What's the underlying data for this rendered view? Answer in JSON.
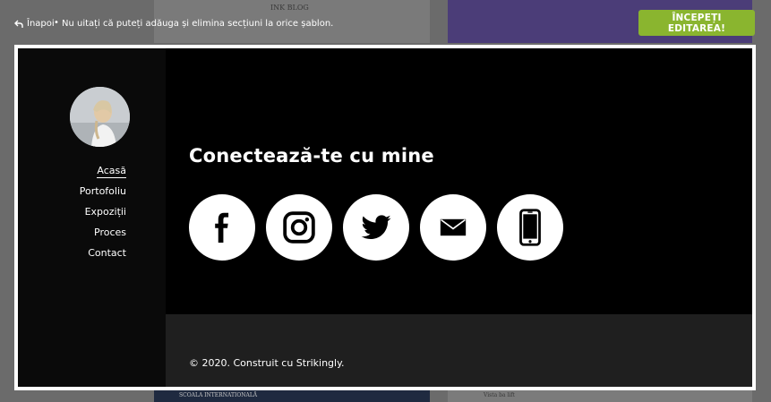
{
  "topbar": {
    "back_label": "Înapoi",
    "separator": "•",
    "hint": "Nu uitați că puteți adăuga și elimina secțiuni la orice șablon.",
    "start_button": "ÎNCEPEȚI EDITAREA!"
  },
  "background": {
    "left_top_logo": "INK BLOG",
    "left_bottom_text": "SCOALA INTERNATIONALĂ",
    "right_bottom_text": "Vista ba lift"
  },
  "sidebar": {
    "items": [
      {
        "label": "Acasă",
        "active": true
      },
      {
        "label": "Portofoliu",
        "active": false
      },
      {
        "label": "Expoziții",
        "active": false
      },
      {
        "label": "Proces",
        "active": false
      },
      {
        "label": "Contact",
        "active": false
      }
    ]
  },
  "main": {
    "heading": "Conectează-te cu mine",
    "social": [
      {
        "icon": "facebook-icon"
      },
      {
        "icon": "instagram-icon"
      },
      {
        "icon": "twitter-icon"
      },
      {
        "icon": "email-icon"
      },
      {
        "icon": "phone-icon"
      }
    ]
  },
  "footer": {
    "copyright": "© 2020. Construit cu Strikingly."
  },
  "colors": {
    "accent": "#8ab52f",
    "page_bg": "#000000",
    "footer_bg": "#1f1f1f"
  }
}
